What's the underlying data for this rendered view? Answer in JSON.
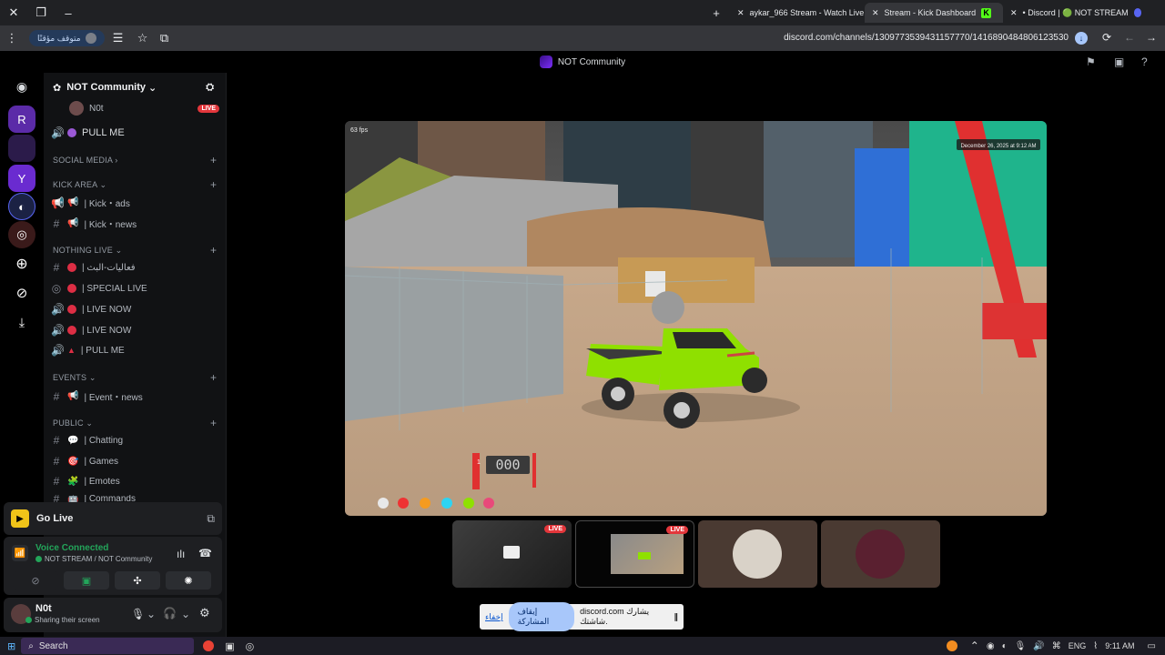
{
  "browser": {
    "tabs": [
      {
        "title": "aykar_966 Stream - Watch Live"
      },
      {
        "title": "Stream - Kick Dashboard"
      },
      {
        "title": "• Discord | 🟢 NOT STREAM"
      }
    ],
    "paused_label": "متوقف مؤقتًا",
    "url": "discord.com/channels/1309773539431157770/1416890484806123530"
  },
  "discord": {
    "window_title": "NOT Community",
    "server_name": "NOT Community",
    "top_user": {
      "name": "N0t",
      "live": "LIVE"
    },
    "channels": {
      "pull_me": "PULL ME",
      "social_media": "SOCIAL MEDIA",
      "kick_area": "KICK AREA",
      "kick_ads": "| Kick・ads",
      "kick_news": "| Kick・news",
      "nothing_live": "NOTHING LIVE",
      "fal": "| فعاليات-البث",
      "special_live": "| SPECIAL LIVE",
      "live_now_1": "| LIVE NOW",
      "live_now_2": "| LIVE NOW",
      "pull_me_2": "| PULL ME",
      "events": "EVENTS",
      "event_news": "| Event・news",
      "public": "PUBLIC",
      "chatting": "| Chatting",
      "games": "| Games",
      "emotes": "| Emotes",
      "commands": "| Commands"
    },
    "golive_label": "Go Live",
    "voice": {
      "status": "Voice Connected",
      "channel": "NOT STREAM / NOT Community"
    },
    "user": {
      "name": "N0t",
      "status": "Sharing their screen"
    },
    "tiles": [
      {
        "live": "LIVE"
      },
      {
        "live": "LIVE"
      }
    ]
  },
  "stream": {
    "fps": "63 fps",
    "date_overlay": "December 26, 2025 at 9:12 AM",
    "speed": "000",
    "gear": "1"
  },
  "sharebar": {
    "hide": "إخفاء",
    "stop": "إيقاف المشاركة",
    "message": "discord.com يشارك شاشتك."
  },
  "taskbar": {
    "search_placeholder": "Search",
    "lang": "ENG",
    "time": "9:11 AM"
  },
  "colors": {
    "discord_bg": "#111214",
    "live_red": "#e3363b",
    "voice_green": "#23a55a",
    "truck_green": "#8fe000"
  }
}
